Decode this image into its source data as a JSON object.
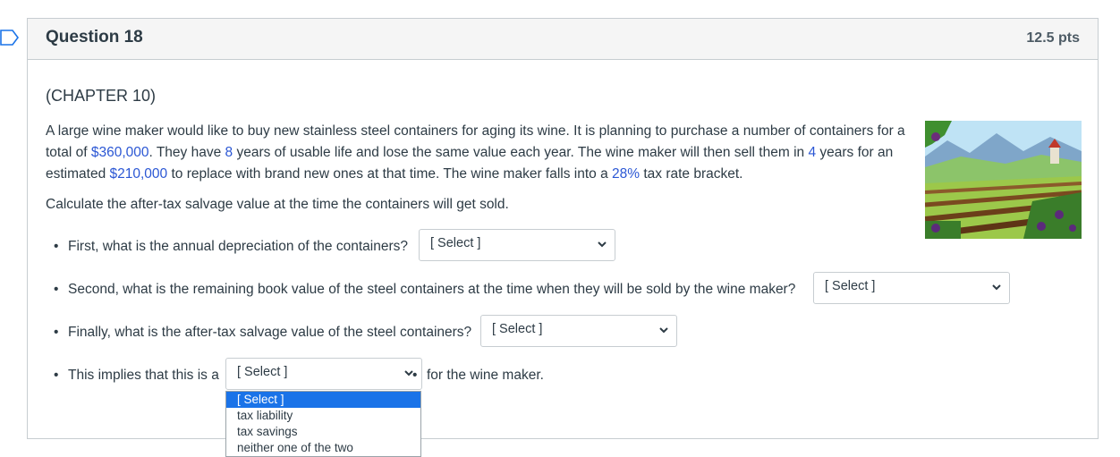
{
  "question": {
    "title": "Question 18",
    "points": "12.5 pts"
  },
  "chapter": "(CHAPTER 10)",
  "paragraph": {
    "t1": "A large wine maker would like to buy new stainless steel containers for aging its wine. It is planning to purchase a number of containers for a total of ",
    "v1": "$360,000",
    "t2": ". They have ",
    "v2": "8",
    "t3": " years of usable life and lose the same value each year. The wine maker will then sell them in ",
    "v3": "4",
    "t4": " years for an estimated ",
    "v4": "$210,000",
    "t5": " to replace with brand new ones at that time. The wine maker falls into a ",
    "v5": "28%",
    "t6": " tax rate bracket."
  },
  "calculate": "Calculate the after-tax salvage value at the time the containers will get sold.",
  "bullets": [
    {
      "text": "First, what is the annual depreciation of the containers?",
      "select": "[ Select ]"
    },
    {
      "text": "Second, what is the remaining book value of the steel containers at the time when they will be sold by the wine maker?",
      "select": "[ Select ]"
    },
    {
      "text": "Finally, what is the after-tax salvage value of the steel containers?",
      "select": "[ Select ]"
    },
    {
      "text": "This implies that this is a",
      "select": "[ Select ]",
      "suffix": "for the wine maker."
    }
  ],
  "dropdown_options": [
    "[ Select ]",
    "tax liability",
    "tax savings",
    "neither one of the two"
  ],
  "colors": {
    "highlight": "#2b57d4",
    "accent": "#1a73e8"
  }
}
